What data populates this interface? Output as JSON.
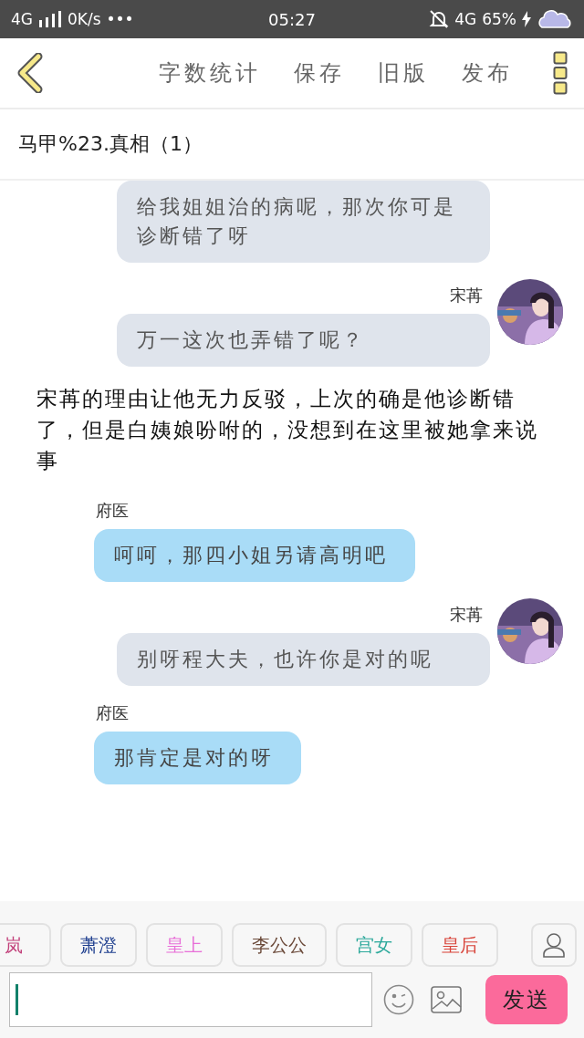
{
  "status_bar": {
    "network": "4G",
    "speed": "0K/s",
    "more": "•••",
    "time": "05:27",
    "network_right": "4G",
    "battery": "65%"
  },
  "header": {
    "actions": [
      "字数统计",
      "保存",
      "旧版",
      "发布"
    ]
  },
  "title": "马甲%23.真相（1）",
  "messages": [
    {
      "kind": "self",
      "text": "给我姐姐治的病呢，那次你可是诊断错了呀"
    },
    {
      "kind": "self",
      "name": "宋苒",
      "text": "万一这次也弄错了呢？"
    },
    {
      "kind": "narration",
      "text": "宋苒的理由让他无力反驳，上次的确是他诊断错了，但是白姨娘吩咐的，没想到在这里被她拿来说事"
    },
    {
      "kind": "other",
      "name": "府医",
      "text": "呵呵，那四小姐另请高明吧"
    },
    {
      "kind": "self",
      "name": "宋苒",
      "text": "别呀程大夫，也许你是对的呢"
    },
    {
      "kind": "other",
      "name": "府医",
      "text": "那肯定是对的呀"
    }
  ],
  "characters": [
    {
      "name": "岚",
      "color": "#c2407a"
    },
    {
      "name": "萧澄",
      "color": "#1f3f8f"
    },
    {
      "name": "皇上",
      "color": "#e86fd8"
    },
    {
      "name": "李公公",
      "color": "#6b4a3a"
    },
    {
      "name": "宫女",
      "color": "#2aa89a"
    },
    {
      "name": "皇后",
      "color": "#d8443a"
    }
  ],
  "composer": {
    "send": "发送"
  }
}
